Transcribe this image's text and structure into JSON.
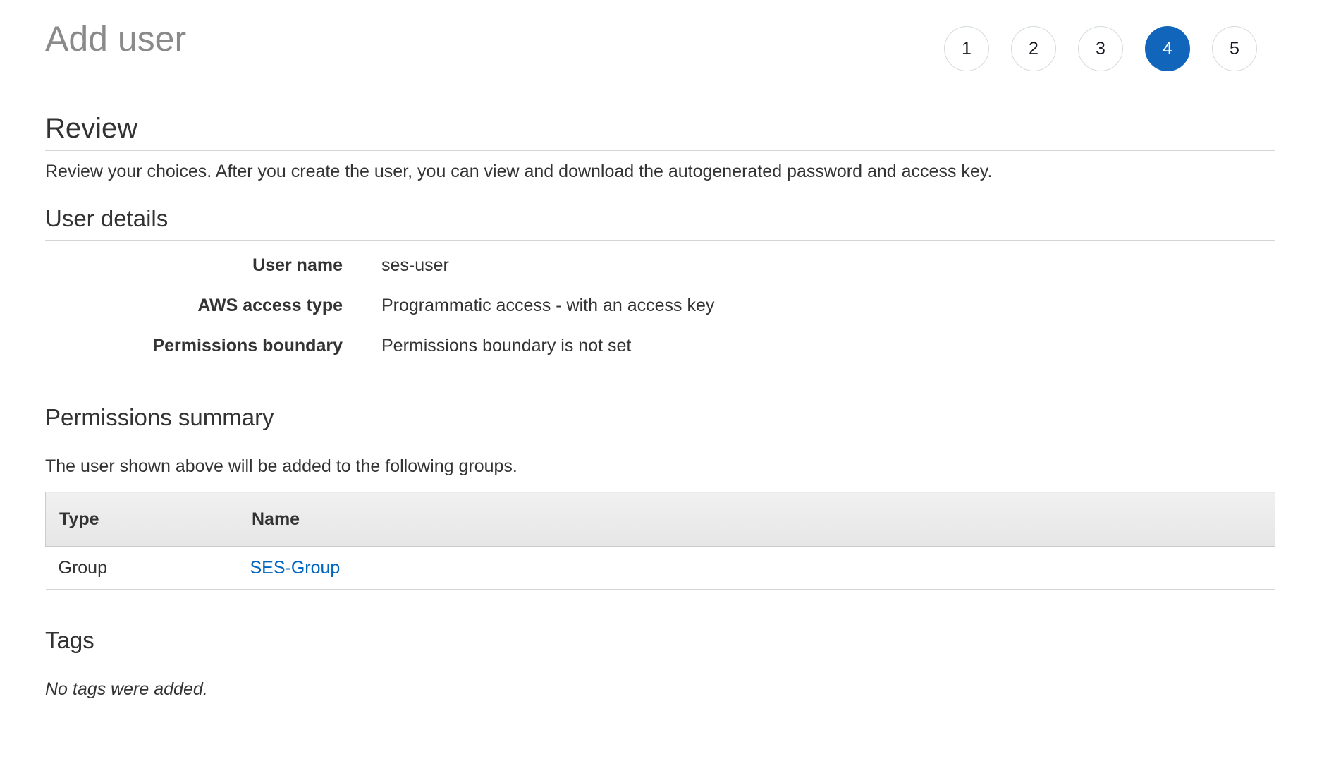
{
  "header": {
    "title": "Add user",
    "steps": [
      {
        "label": "1",
        "active": false
      },
      {
        "label": "2",
        "active": false
      },
      {
        "label": "3",
        "active": false
      },
      {
        "label": "4",
        "active": true
      },
      {
        "label": "5",
        "active": false
      }
    ],
    "active_step_color": "#1166bb"
  },
  "review": {
    "title": "Review",
    "description": "Review your choices. After you create the user, you can view and download the autogenerated password and access key."
  },
  "user_details": {
    "title": "User details",
    "rows": [
      {
        "label": "User name",
        "value": "ses-user"
      },
      {
        "label": "AWS access type",
        "value": "Programmatic access - with an access key"
      },
      {
        "label": "Permissions boundary",
        "value": "Permissions boundary is not set"
      }
    ]
  },
  "permissions_summary": {
    "title": "Permissions summary",
    "description": "The user shown above will be added to the following groups.",
    "table": {
      "headers": [
        "Type",
        "Name"
      ],
      "rows": [
        {
          "type": "Group",
          "name": "SES-Group"
        }
      ]
    },
    "link_color": "#0066c0"
  },
  "tags": {
    "title": "Tags",
    "empty_message": "No tags were added."
  }
}
